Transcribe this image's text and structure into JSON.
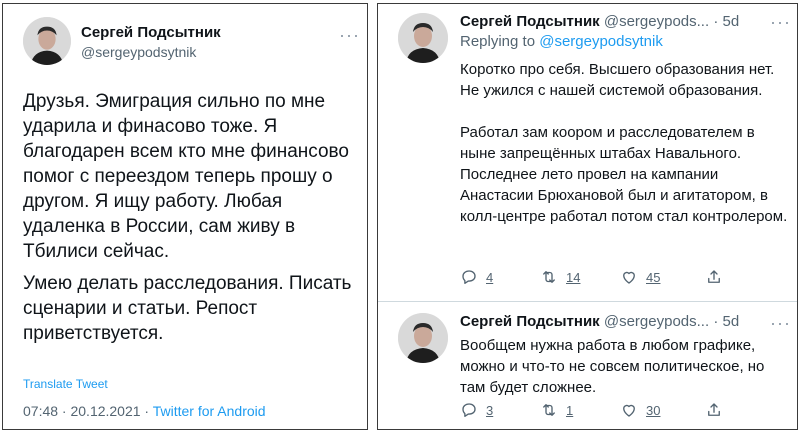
{
  "left_tweet": {
    "author_name": "Сергей Подсытник",
    "author_handle": "@sergeypodsytnik",
    "paragraph1": "Друзья. Эмиграция сильно по мне ударила и финасово тоже. Я благодарен всем кто мне финансово помог с переездом теперь прошу о другом. Я ищу работу. Любая удаленка в России, сам живу в Тбилиси сейчас.",
    "paragraph2": "Умею делать расследования. Писать сценарии и статьи. Репост приветствуется.",
    "translate_label": "Translate Tweet",
    "timestamp": "07:48 · 20.12.2021 · ",
    "source": "Twitter for Android"
  },
  "reply1": {
    "author_name": "Сергей Подсытник",
    "author_handle": "@sergeypods...",
    "time": "· 5d",
    "replying_prefix": "Replying to ",
    "replying_handle": "@sergeypodsytnik",
    "paragraph1": "Коротко про себя. Высшего образования нет. Не ужился с нашей системой образования.",
    "paragraph2": "Работал зам коором и расследователем в ныне запрещённых штабах Навального. Последнее лето провел на кампании Анастасии Брюхановой был и агитатором, в колл-центре работал потом стал контролером.",
    "replies": "4",
    "retweets": "14",
    "likes": "45"
  },
  "reply2": {
    "author_name": "Сергей Подсытник",
    "author_handle": "@sergeypods...",
    "time": "· 5d",
    "text": "Вообщем нужна работа в любом графике, можно и что-то не совсем политическое, но там будет сложнее.",
    "replies": "3",
    "retweets": "1",
    "likes": "30"
  },
  "more_label": "···",
  "icons": [
    "more-options-icon",
    "reply-icon",
    "retweet-icon",
    "like-icon",
    "share-icon"
  ],
  "colors": {
    "accent": "#1d9bf0",
    "text": "#0f1419",
    "secondary": "#536471",
    "border": "#3a3a3a"
  }
}
